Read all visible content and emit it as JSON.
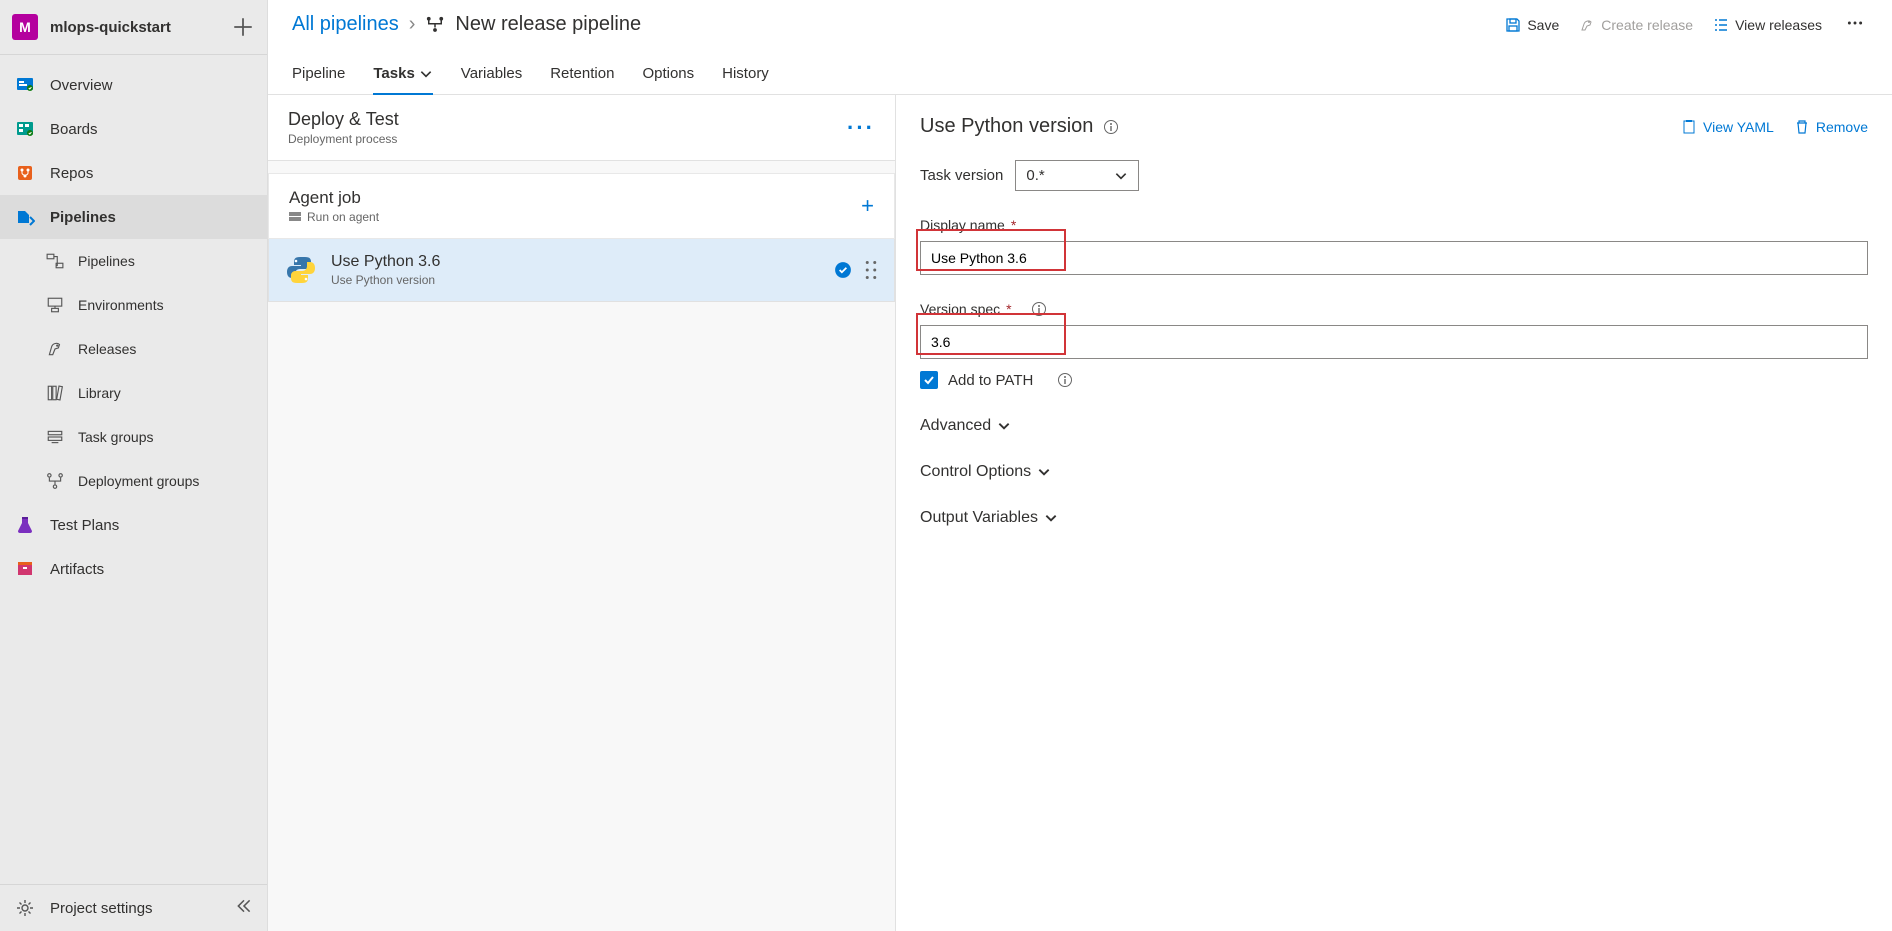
{
  "project": {
    "avatar_letter": "M",
    "name": "mlops-quickstart"
  },
  "sidebar": {
    "items": [
      {
        "label": "Overview"
      },
      {
        "label": "Boards"
      },
      {
        "label": "Repos"
      },
      {
        "label": "Pipelines"
      },
      {
        "label": "Pipelines"
      },
      {
        "label": "Environments"
      },
      {
        "label": "Releases"
      },
      {
        "label": "Library"
      },
      {
        "label": "Task groups"
      },
      {
        "label": "Deployment groups"
      },
      {
        "label": "Test Plans"
      },
      {
        "label": "Artifacts"
      }
    ],
    "footer": "Project settings"
  },
  "breadcrumb": {
    "root": "All pipelines",
    "sep": "›",
    "title": "New release pipeline"
  },
  "top_actions": {
    "save": "Save",
    "create_release": "Create release",
    "view_releases": "View releases"
  },
  "tabs": [
    "Pipeline",
    "Tasks",
    "Variables",
    "Retention",
    "Options",
    "History"
  ],
  "stage": {
    "title": "Deploy & Test",
    "subtitle": "Deployment process"
  },
  "agent": {
    "title": "Agent job",
    "subtitle": "Run on agent"
  },
  "task": {
    "title": "Use Python 3.6",
    "subtitle": "Use Python version"
  },
  "detail": {
    "title": "Use Python version",
    "view_yaml": "View YAML",
    "remove": "Remove",
    "task_version_label": "Task version",
    "task_version_value": "0.*",
    "display_name_label": "Display name",
    "display_name_value": "Use Python 3.6",
    "version_spec_label": "Version spec",
    "version_spec_value": "3.6",
    "add_to_path_label": "Add to PATH",
    "advanced": "Advanced",
    "control_options": "Control Options",
    "output_variables": "Output Variables"
  }
}
